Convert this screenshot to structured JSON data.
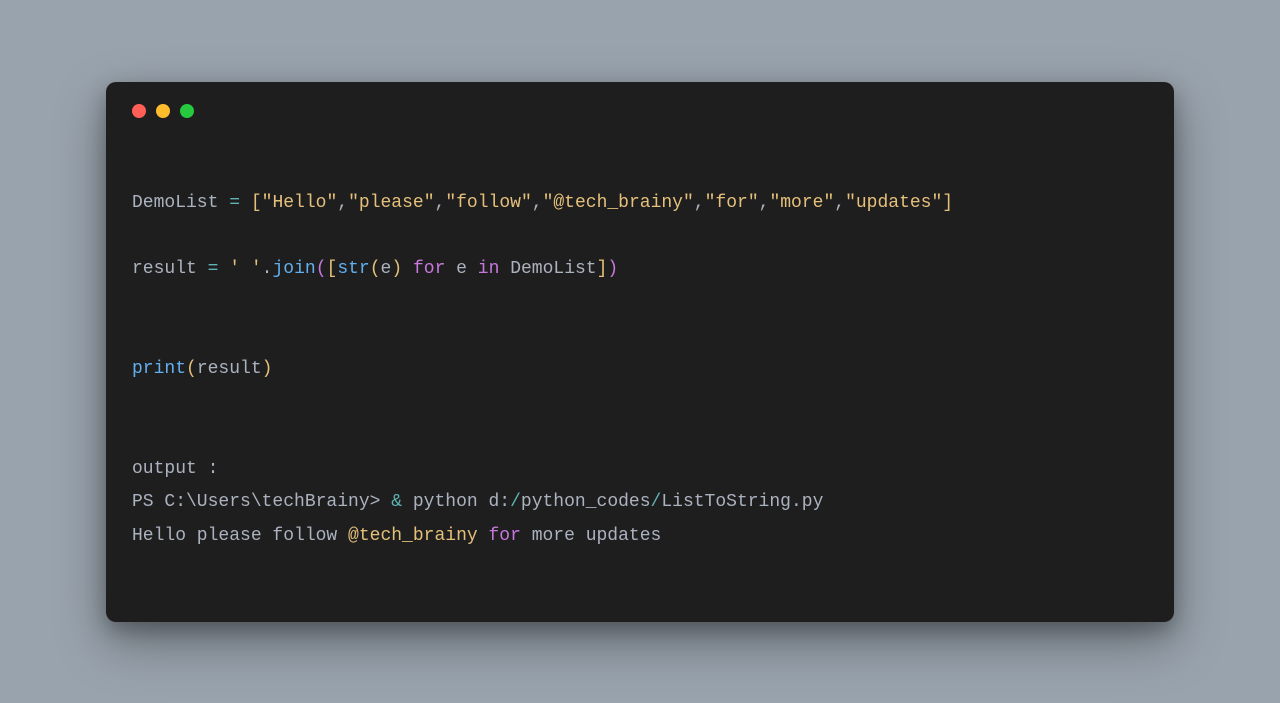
{
  "dots": {
    "red": "#ff5f56",
    "yellow": "#ffbd2e",
    "green": "#27c93f"
  },
  "code": {
    "l1": {
      "var": "DemoList ",
      "op": "=",
      "sp": " ",
      "lb": "[",
      "s1": "\"Hello\"",
      "c": ",",
      "s2": "\"please\"",
      "s3": "\"follow\"",
      "s4": "\"@tech_brainy\"",
      "s5": "\"for\"",
      "s6": "\"more\"",
      "s7": "\"updates\"",
      "rb": "]"
    },
    "l2": {
      "var": "result ",
      "op": "=",
      "sp": " ",
      "q": "' '",
      "dot": ".",
      "join": "join",
      "lp": "(",
      "lb": "[",
      "str": "str",
      "lp2": "(",
      "e": "e",
      "rp2": ")",
      "sp2": " ",
      "for": "for",
      "sp3": " e ",
      "in": "in",
      "sp4": " DemoList",
      "rb": "]",
      "rp": ")"
    },
    "l3": {
      "print": "print",
      "lp": "(",
      "arg": "result",
      "rp": ")"
    },
    "l4": {
      "text": "output :"
    },
    "l5": {
      "a": "PS C:\\Users\\techBrainy> ",
      "amp": "&",
      "b": " python d:",
      "sl": "/",
      "c": "python_codes",
      "sl2": "/",
      "d": "ListToString.py"
    },
    "l6": {
      "a": "Hello please follow ",
      "at": "@tech_brainy",
      "sp": " ",
      "for": "for",
      "b": " more updates"
    }
  }
}
